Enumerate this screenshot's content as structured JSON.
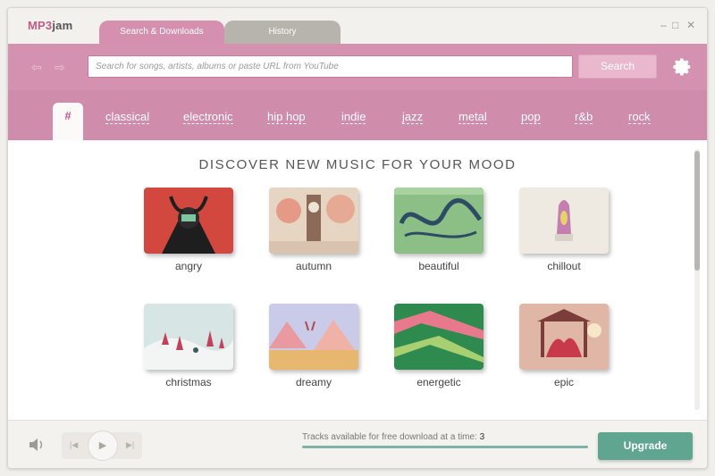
{
  "app": {
    "logo_mp3": "MP3",
    "logo_jam": "jam"
  },
  "tabs": [
    {
      "label": "Search & Downloads",
      "active": true
    },
    {
      "label": "History",
      "active": false
    }
  ],
  "window_controls": {
    "minimize": "–",
    "maximize": "□",
    "close": "✕"
  },
  "search": {
    "placeholder": "Search for songs, artists, albums or paste URL from YouTube",
    "button_label": "Search"
  },
  "genres": {
    "active": "#",
    "items": [
      "classical",
      "electronic",
      "hip hop",
      "indie",
      "jazz",
      "metal",
      "pop",
      "r&b",
      "rock"
    ]
  },
  "main": {
    "heading": "DISCOVER NEW MUSIC FOR YOUR MOOD",
    "moods": [
      {
        "label": "angry",
        "color": "#d2483e"
      },
      {
        "label": "autumn",
        "color": "#e7d5c3"
      },
      {
        "label": "beautiful",
        "color": "#8cbf85"
      },
      {
        "label": "chillout",
        "color": "#eeeae2"
      },
      {
        "label": "christmas",
        "color": "#d7e6e4"
      },
      {
        "label": "dreamy",
        "color": "#c9cbe8"
      },
      {
        "label": "energetic",
        "color": "#2f8a4f"
      },
      {
        "label": "epic",
        "color": "#e0b7a6"
      }
    ]
  },
  "footer": {
    "tracks_label": "Tracks available for free download at a time:",
    "tracks_count": "3",
    "upgrade_label": "Upgrade"
  },
  "icons": [
    "back-arrow-icon",
    "forward-arrow-icon",
    "gear-icon",
    "volume-icon",
    "previous-icon",
    "play-icon",
    "next-icon"
  ],
  "colors": {
    "accent": "#d492b0",
    "brand": "#c25b86",
    "upgrade": "#5fa58f"
  }
}
